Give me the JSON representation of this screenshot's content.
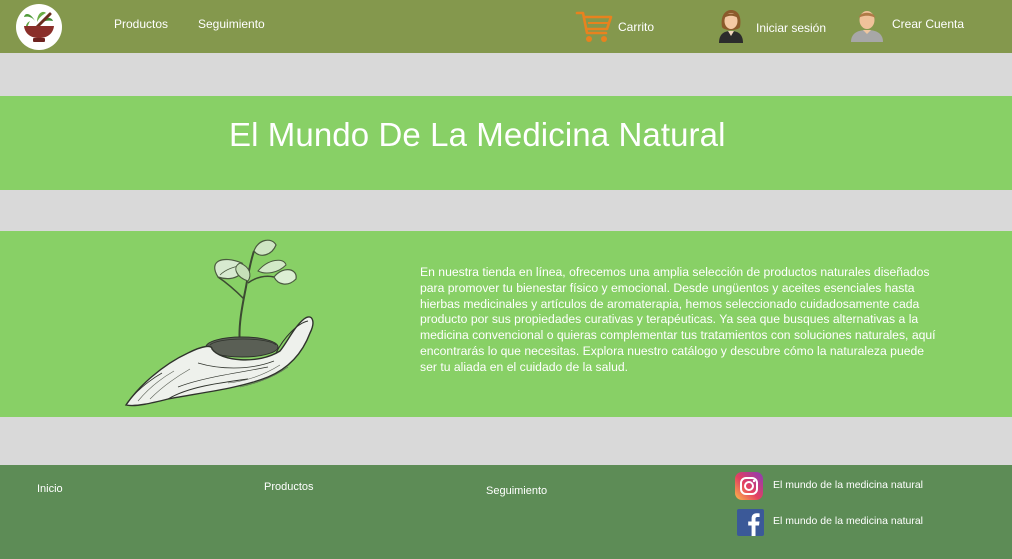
{
  "nav": {
    "products": "Productos",
    "tracking": "Seguimiento",
    "cart": "Carrito",
    "login": "Iniciar sesión",
    "signup": "Crear Cuenta"
  },
  "hero": {
    "title": "El Mundo De La Medicina Natural"
  },
  "about": {
    "text": "En nuestra tienda en línea, ofrecemos una amplia selección de productos naturales diseñados para promover tu bienestar físico y emocional. Desde ungüentos y aceites esenciales hasta hierbas medicinales y artículos de aromaterapia, hemos seleccionado cuidadosamente cada producto por sus propiedades curativas y terapéuticas. Ya sea que busques alternativas a la medicina convencional o quieras complementar tus tratamientos con soluciones naturales, aquí encontrarás lo que necesitas. Explora nuestro catálogo y descubre cómo la naturaleza puede ser tu aliada en el cuidado de la salud."
  },
  "footer": {
    "home": "Inicio",
    "products": "Productos",
    "tracking": "Seguimiento",
    "instagram_label": "El mundo de la medicina natural",
    "facebook_label": "El mundo de la medicina natural"
  },
  "icons": {
    "logo": "mortar-pestle-herbs-logo",
    "cart": "shopping-cart-icon",
    "login": "woman-avatar-icon",
    "signup": "man-avatar-icon",
    "instagram": "instagram-icon",
    "facebook": "facebook-icon"
  },
  "colors": {
    "navbar": "#84984d",
    "band_green": "#88d066",
    "footer": "#5d8c56",
    "background": "#d9d9d9",
    "cart_orange": "#e8821e"
  }
}
